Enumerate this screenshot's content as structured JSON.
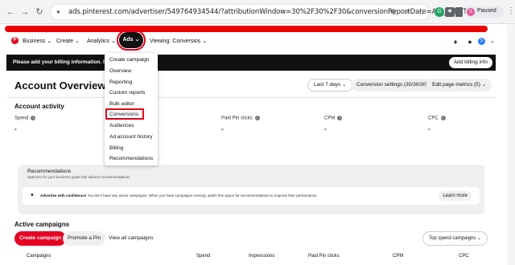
{
  "browser": {
    "url": "ads.pinterest.com/advertiser/549764934544/?attributionWindow=30%2F30%2F30&conversionReportDate=AD_EVENT",
    "profile_initial": "S",
    "profile_label": "Paused"
  },
  "header": {
    "nav": [
      "Business",
      "Create",
      "Analytics",
      "Ads",
      "Viewing: Conversios"
    ],
    "user_initial": "S",
    "accent_color": "#e60023",
    "highlight_color": "#e0001b"
  },
  "banner": {
    "text": "Please add your billing information. It'll on",
    "button": "Add billing info"
  },
  "ads_menu": {
    "items": [
      "Create campaign",
      "Overview",
      "Reporting",
      "Custom reports",
      "Bulk editor",
      "Conversions",
      "Audiences",
      "Ad account history",
      "Billing",
      "Recommendations"
    ],
    "highlighted": "Conversions"
  },
  "overview": {
    "title": "Account Overview",
    "date_range": "Last 7 days",
    "conversion_settings": "Conversion settings (30/30/30)",
    "edit_metrics": "Edit page metrics (5)",
    "activity_title": "Account activity",
    "metrics": [
      {
        "label": "Spend",
        "value": "-"
      },
      {
        "label": "Paid Pin clicks",
        "value": "-"
      },
      {
        "label": "CPM",
        "value": "-"
      },
      {
        "label": "CPC",
        "value": "-"
      }
    ]
  },
  "recommendations": {
    "title": "Recommendations",
    "subtitle": "Optimize for your business goals with tailored recommendations",
    "headline": "Advertise with confidence!",
    "body": "You don't have any active campaigns. When you have campaigns running, watch this space for recommendations to improve their performance.",
    "button": "Learn more"
  },
  "campaigns": {
    "title": "Active campaigns",
    "create_button": "Create campaign",
    "promote_button": "Promote a Pin",
    "view_all": "View all campaigns",
    "sort": "Top spend campaigns",
    "columns": [
      "Campaigns",
      "Spend",
      "Impressions",
      "Paid Pin clicks",
      "CPM",
      "CPC"
    ]
  },
  "icons": {
    "back": "back-arrow-icon",
    "forward": "forward-arrow-icon",
    "reload": "reload-icon",
    "bell": "bell-icon",
    "messages": "messages-icon",
    "chevron": "chevron-down-icon"
  }
}
